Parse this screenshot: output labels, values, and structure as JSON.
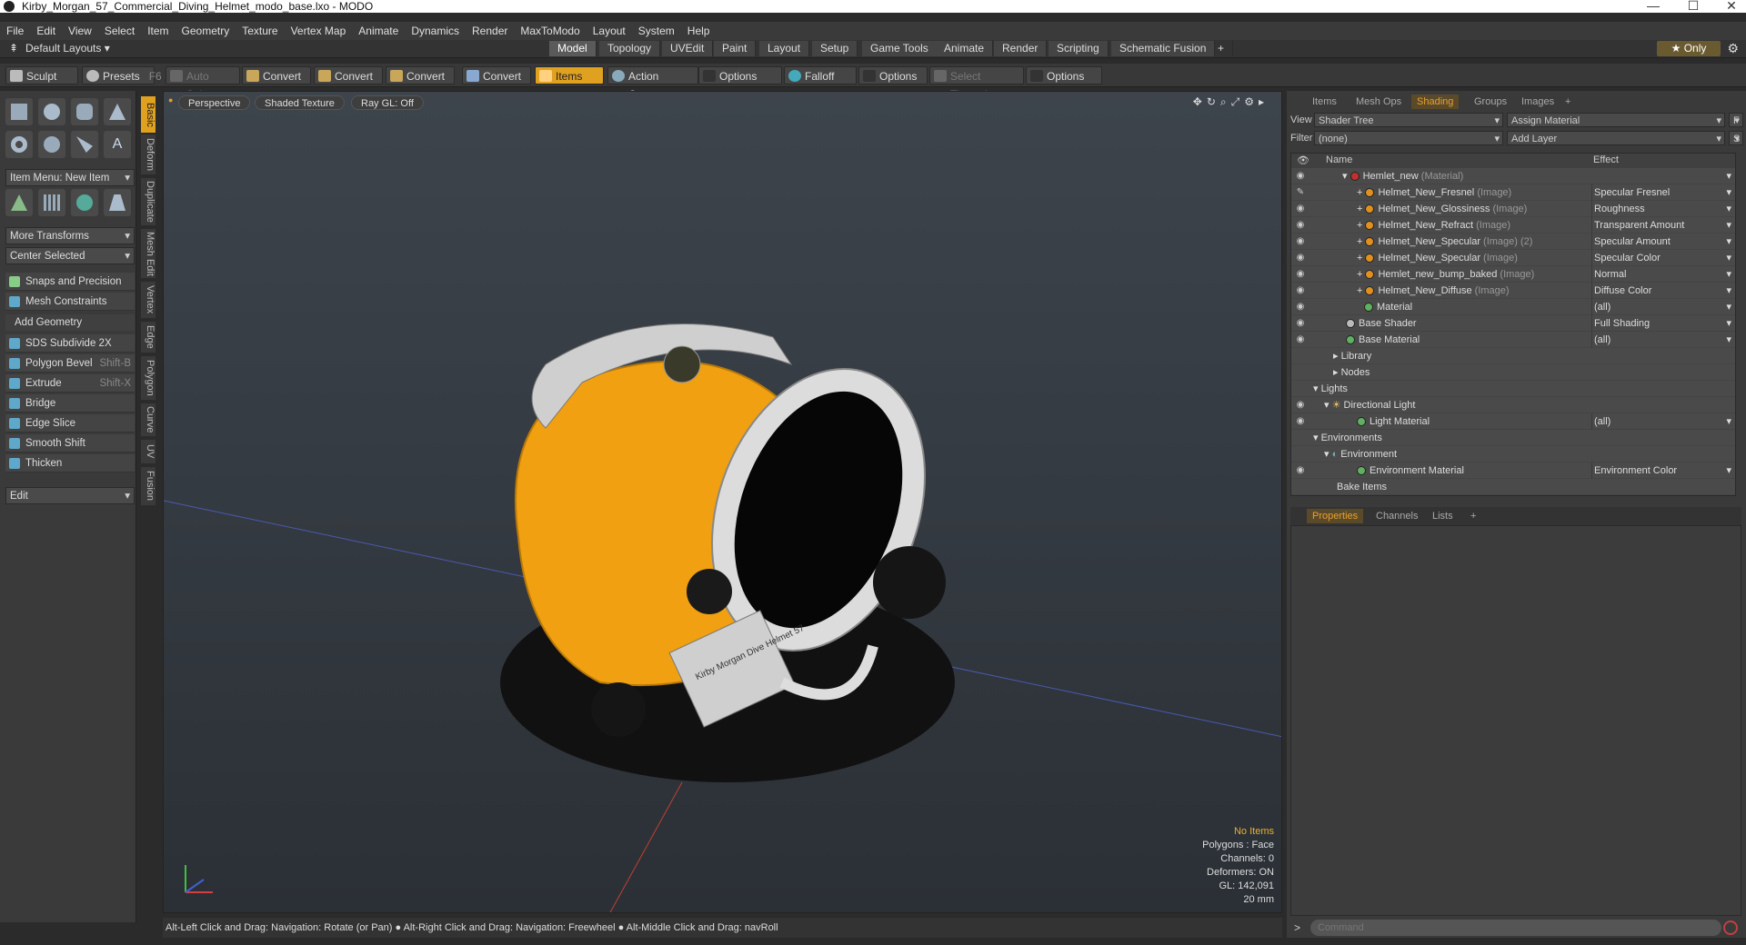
{
  "window": {
    "title": "Kirby_Morgan_57_Commercial_Diving_Helmet_modo_base.lxo - MODO",
    "minimize": "—",
    "maximize": "☐",
    "close": "✕"
  },
  "menu": [
    "File",
    "Edit",
    "View",
    "Select",
    "Item",
    "Geometry",
    "Texture",
    "Vertex Map",
    "Animate",
    "Dynamics",
    "Render",
    "MaxToModo",
    "Layout",
    "System",
    "Help"
  ],
  "layout_tabs": {
    "default_layouts": "Default Layouts ▾",
    "tabs": [
      "Model",
      "Topology",
      "UVEdit",
      "Paint",
      "Layout",
      "Setup",
      "Game Tools",
      "Animate",
      "Render",
      "Scripting",
      "Schematic Fusion",
      "+"
    ],
    "active": "Model",
    "only": "★  Only"
  },
  "toolbar": {
    "sculpt": "Sculpt",
    "presets": "Presets",
    "presets_key": "F6",
    "auto_select": "Auto Select",
    "convert": "Convert",
    "items": "Items",
    "action_center": "Action Center",
    "options": "Options",
    "falloff": "Falloff",
    "select_through": "Select Through"
  },
  "left": {
    "item_menu": "Item Menu: New Item",
    "more_transforms": "More Transforms",
    "center_selected": "Center Selected",
    "snaps": "Snaps and Precision",
    "mesh_constraints": "Mesh Constraints",
    "add_geometry": "Add Geometry",
    "tools": [
      {
        "label": "SDS Subdivide 2X",
        "key": ""
      },
      {
        "label": "Polygon Bevel",
        "key": "Shift-B"
      },
      {
        "label": "Extrude",
        "key": "Shift-X"
      },
      {
        "label": "Bridge",
        "key": ""
      },
      {
        "label": "Edge Slice",
        "key": ""
      },
      {
        "label": "Smooth Shift",
        "key": ""
      },
      {
        "label": "Thicken",
        "key": ""
      }
    ],
    "edit": "Edit",
    "side_tabs": [
      "Basic",
      "Deform",
      "Duplicate",
      "Mesh Edit",
      "Vertex",
      "Edge",
      "Polygon",
      "Curve",
      "UV",
      "Fusion"
    ]
  },
  "viewport": {
    "perspective": "Perspective",
    "shading": "Shaded Texture",
    "raygl": "Ray GL: Off",
    "hud": {
      "items": "No Items",
      "polygons": "Polygons : Face",
      "channels": "Channels: 0",
      "deformers": "Deformers: ON",
      "gl": "GL: 142,091",
      "scale": "20 mm"
    },
    "helmet_label": "Kirby Morgan Dive Helmet 57"
  },
  "status": "Alt-Left Click and Drag: Navigation: Rotate (or Pan) ● Alt-Right Click and Drag: Navigation: Freewheel ● Alt-Middle Click and Drag: navRoll",
  "right": {
    "tabs": [
      "Items",
      "Mesh Ops",
      "Shading",
      "Groups",
      "Images",
      "+"
    ],
    "active": "Shading",
    "view_label": "View",
    "view_value": "Shader Tree",
    "assign_material": "Assign Material",
    "f_btn": "F",
    "filter_label": "Filter",
    "filter_value": "(none)",
    "add_layer": "Add Layer",
    "s_btn": "S",
    "col_name": "Name",
    "col_effect": "Effect",
    "rows": [
      {
        "name": "Hemlet_new",
        "tag": "(Material)",
        "effect": ""
      },
      {
        "name": "Helmet_New_Fresnel",
        "tag": "(Image)",
        "effect": "Specular Fresnel"
      },
      {
        "name": "Helmet_New_Glossiness",
        "tag": "(Image)",
        "effect": "Roughness"
      },
      {
        "name": "Helmet_New_Refract",
        "tag": "(Image)",
        "effect": "Transparent Amount"
      },
      {
        "name": "Helmet_New_Specular",
        "tag": "(Image) (2)",
        "effect": "Specular Amount"
      },
      {
        "name": "Helmet_New_Specular",
        "tag": "(Image)",
        "effect": "Specular Color"
      },
      {
        "name": "Hemlet_new_bump_baked",
        "tag": "(Image)",
        "effect": "Normal"
      },
      {
        "name": "Helmet_New_Diffuse",
        "tag": "(Image)",
        "effect": "Diffuse Color"
      },
      {
        "name": "Material",
        "tag": "",
        "effect": "(all)"
      },
      {
        "name": "Base Shader",
        "tag": "",
        "effect": "Full Shading"
      },
      {
        "name": "Base Material",
        "tag": "",
        "effect": "(all)"
      },
      {
        "name": "Library",
        "tag": "",
        "effect": ""
      },
      {
        "name": "Nodes",
        "tag": "",
        "effect": ""
      },
      {
        "name": "Lights",
        "tag": "",
        "effect": ""
      },
      {
        "name": "Directional Light",
        "tag": "",
        "effect": ""
      },
      {
        "name": "Light Material",
        "tag": "",
        "effect": "(all)"
      },
      {
        "name": "Environments",
        "tag": "",
        "effect": ""
      },
      {
        "name": "Environment",
        "tag": "",
        "effect": ""
      },
      {
        "name": "Environment Material",
        "tag": "",
        "effect": "Environment Color"
      },
      {
        "name": "Bake Items",
        "tag": "",
        "effect": ""
      }
    ],
    "prop_tabs": [
      "Properties",
      "Channels",
      "Lists",
      "+"
    ],
    "command_placeholder": "Command"
  },
  "colors": {
    "accent": "#e0a020",
    "helmet_orange": "#f0a010"
  }
}
